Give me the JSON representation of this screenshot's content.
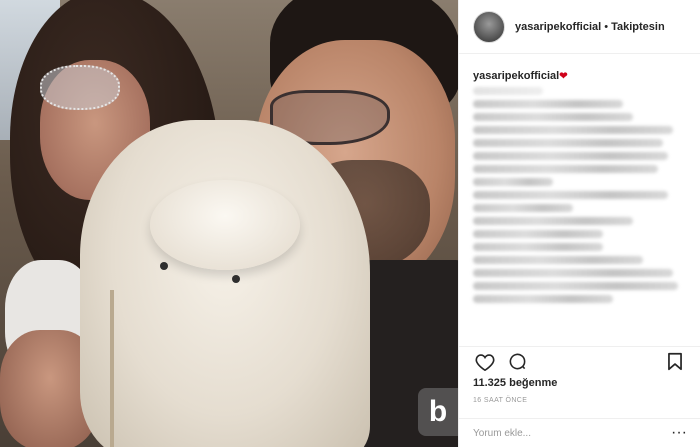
{
  "header": {
    "username": "yasaripekofficial",
    "separator": "•",
    "follow_status": "Takiptesin"
  },
  "caption": {
    "username": "yasaripekofficial",
    "heart": "❤"
  },
  "actions": {
    "like_icon": "heart-outline-icon",
    "comment_icon": "comment-bubble-icon",
    "save_icon": "bookmark-icon"
  },
  "stats": {
    "likes": "11.325 beğenme",
    "time": "16 SAAT ÖNCE"
  },
  "comment_box": {
    "placeholder": "Yorum ekle...",
    "more": "···"
  },
  "watermark": {
    "letter": "b"
  }
}
